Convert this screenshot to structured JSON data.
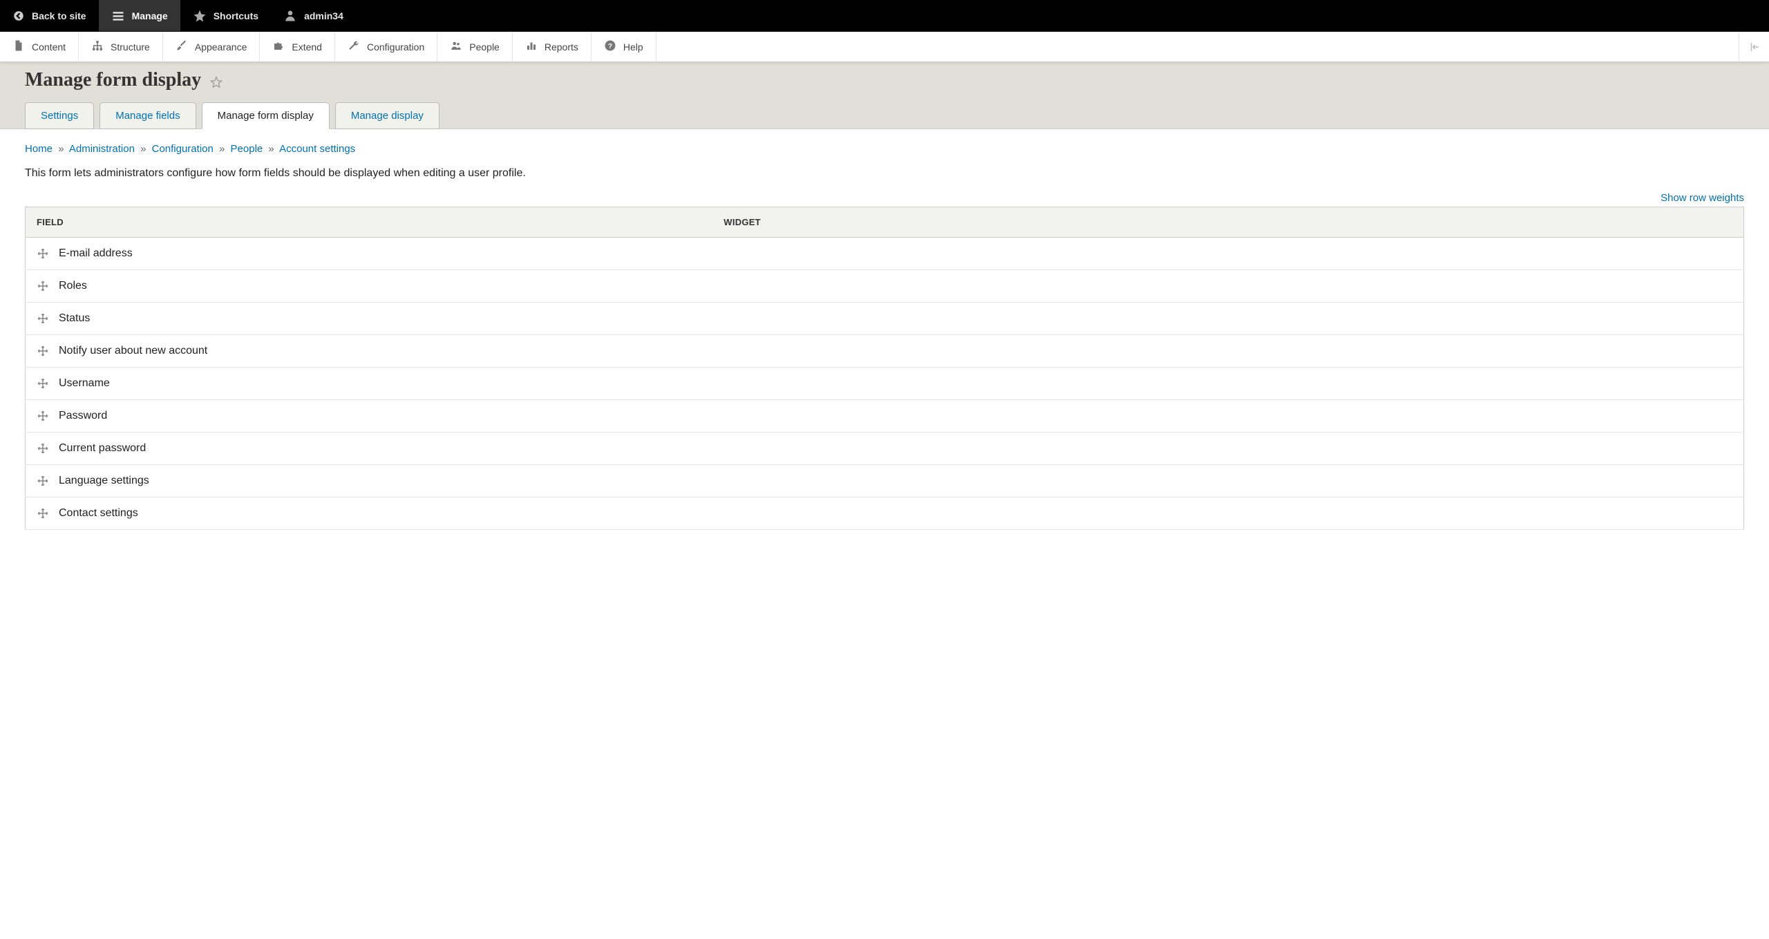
{
  "top_toolbar": {
    "back_label": "Back to site",
    "manage_label": "Manage",
    "shortcuts_label": "Shortcuts",
    "user_label": "admin34"
  },
  "admin_menu": {
    "content": "Content",
    "structure": "Structure",
    "appearance": "Appearance",
    "extend": "Extend",
    "configuration": "Configuration",
    "people": "People",
    "reports": "Reports",
    "help": "Help"
  },
  "page": {
    "title": "Manage form display"
  },
  "tabs": {
    "settings": "Settings",
    "manage_fields": "Manage fields",
    "manage_form_display": "Manage form display",
    "manage_display": "Manage display"
  },
  "breadcrumb": {
    "home": "Home",
    "administration": "Administration",
    "configuration": "Configuration",
    "people": "People",
    "account_settings": "Account settings"
  },
  "description": "This form lets administrators configure how form fields should be displayed when editing a user profile.",
  "show_row_weights": "Show row weights",
  "table": {
    "header_field": "Field",
    "header_widget": "Widget",
    "rows": [
      {
        "label": "E-mail address"
      },
      {
        "label": "Roles"
      },
      {
        "label": "Status"
      },
      {
        "label": "Notify user about new account"
      },
      {
        "label": "Username"
      },
      {
        "label": "Password"
      },
      {
        "label": "Current password"
      },
      {
        "label": "Language settings"
      },
      {
        "label": "Contact settings"
      }
    ]
  }
}
